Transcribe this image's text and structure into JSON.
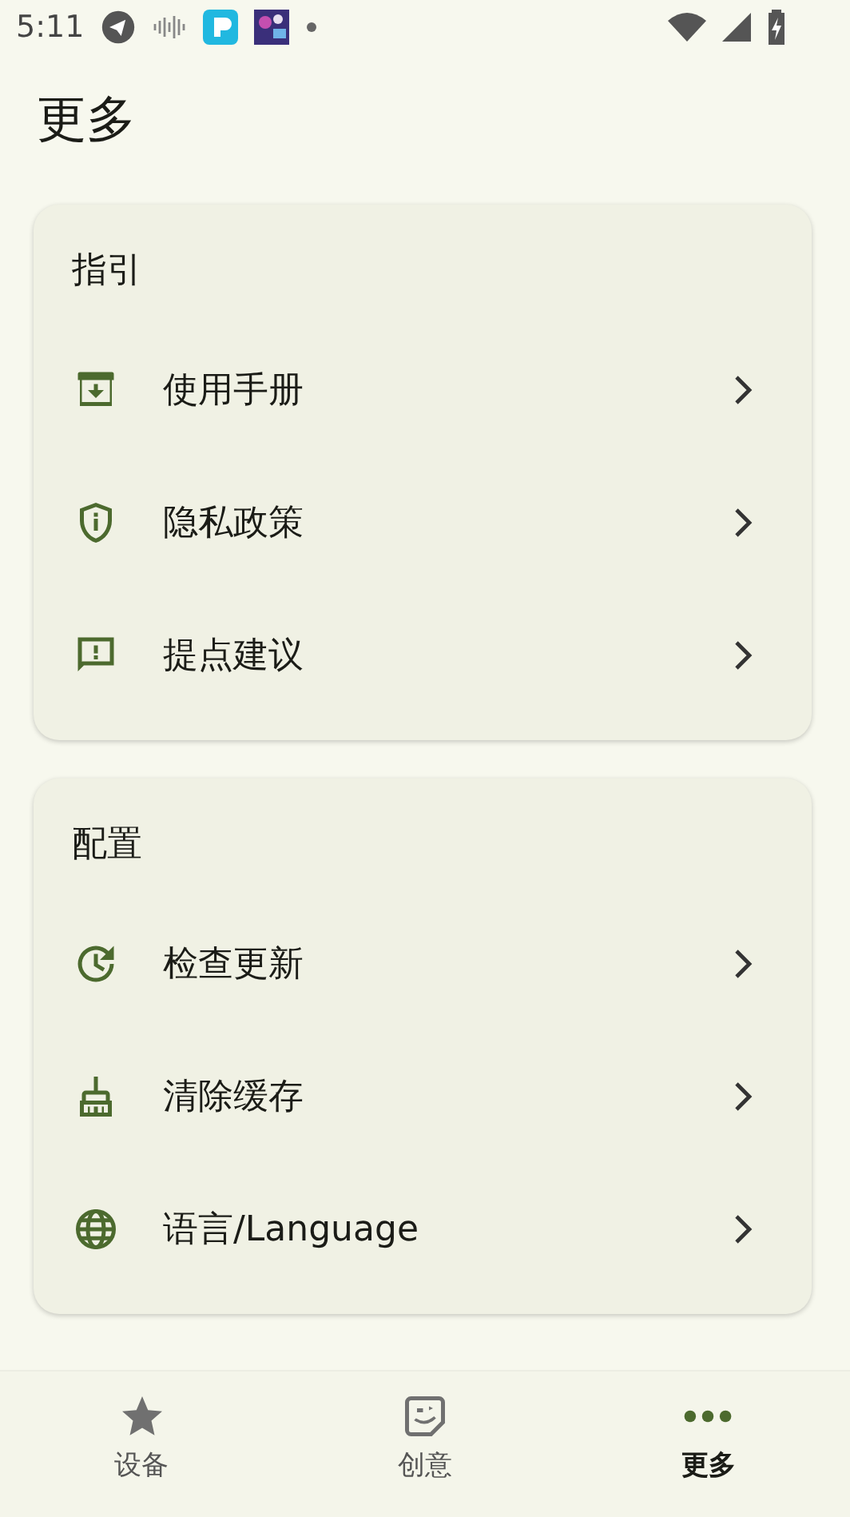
{
  "status_bar": {
    "time": "5:11"
  },
  "title": "更多",
  "sections": [
    {
      "heading": "指引",
      "items": [
        {
          "label": "使用手册"
        },
        {
          "label": "隐私政策"
        },
        {
          "label": "提点建议"
        }
      ]
    },
    {
      "heading": "配置",
      "items": [
        {
          "label": "检查更新"
        },
        {
          "label": "清除缓存"
        },
        {
          "label": "语言/Language"
        }
      ]
    }
  ],
  "bottom_nav": [
    {
      "label": "设备",
      "selected": false
    },
    {
      "label": "创意",
      "selected": false
    },
    {
      "label": "更多",
      "selected": true
    }
  ]
}
